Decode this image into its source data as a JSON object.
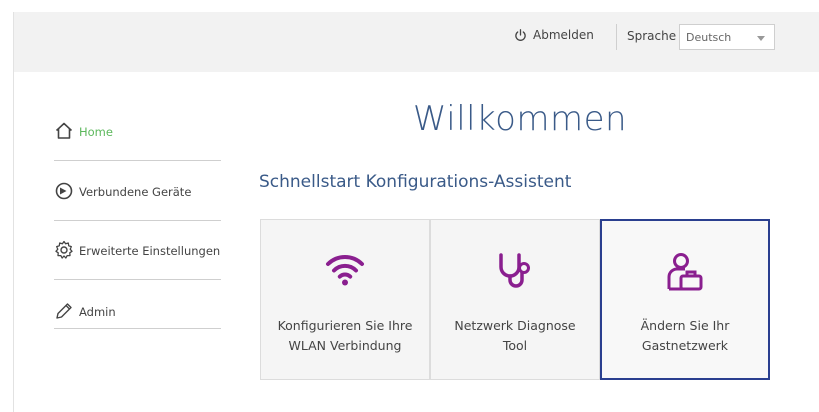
{
  "header": {
    "logout_label": "Abmelden",
    "language_label": "Sprache",
    "language_selected": "Deutsch"
  },
  "sidebar": {
    "items": [
      {
        "label": "Home",
        "icon": "home-icon",
        "active": true
      },
      {
        "label": "Verbundene Geräte",
        "icon": "devices-icon",
        "active": false
      },
      {
        "label": "Erweiterte Einstellungen",
        "icon": "gear-icon",
        "active": false
      },
      {
        "label": "Admin",
        "icon": "pencil-icon",
        "active": false
      }
    ]
  },
  "main": {
    "title": "Willkommen",
    "subtitle": "Schnellstart Konfigurations-Assistent",
    "tiles": [
      {
        "line1": "Konfigurieren Sie Ihre",
        "line2": "WLAN Verbindung",
        "icon": "wifi-icon",
        "selected": false
      },
      {
        "line1": "Netzwerk Diagnose",
        "line2": "Tool",
        "icon": "stethoscope-icon",
        "selected": false
      },
      {
        "line1": "Ändern Sie Ihr",
        "line2": "Gastnetzwerk",
        "icon": "guest-network-icon",
        "selected": true
      }
    ]
  },
  "colors": {
    "accent": "#8a1f8f",
    "title": "#3a5a88",
    "active_nav": "#5cb85c",
    "selected_border": "#2a3f8f"
  }
}
